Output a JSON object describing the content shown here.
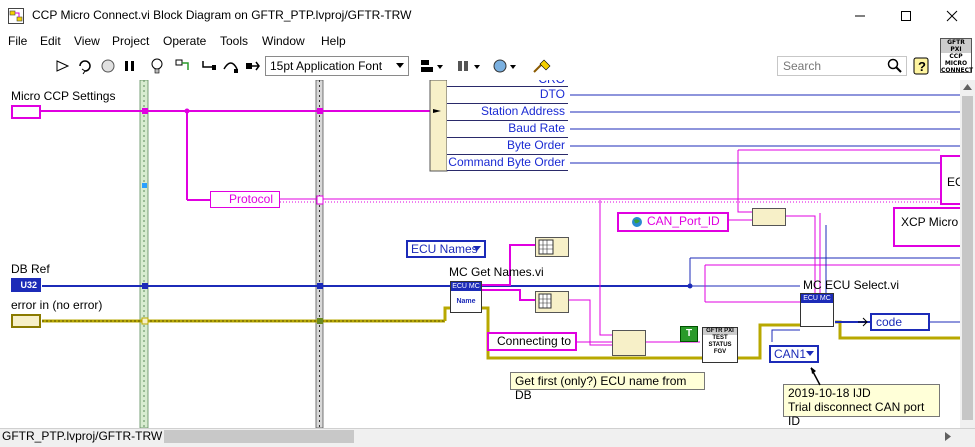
{
  "window": {
    "title": "CCP Micro Connect.vi Block Diagram on GFTR_PTP.lvproj/GFTR-TRW",
    "minimize_icon": "minimize-icon",
    "maximize_icon": "maximize-icon",
    "close_icon": "close-icon"
  },
  "menu": [
    "File",
    "Edit",
    "View",
    "Project",
    "Operate",
    "Tools",
    "Window",
    "Help"
  ],
  "toolbar": {
    "font": "15pt Application Font",
    "search_placeholder": "Search",
    "vi_icon_lines": [
      "GFTR PXI",
      "CCP",
      "MICRO",
      "CONNECT"
    ]
  },
  "diagram": {
    "micro_ccp_settings": "Micro CCP Settings",
    "db_ref": "DB Ref",
    "db_ref_type": "U32",
    "error_in": "error in (no error)",
    "protocol": "Protocol",
    "bundle_fields": [
      "CRO",
      "DTO",
      "Station Address",
      "Baud Rate",
      "Byte Order",
      "Command Byte Order"
    ],
    "can_port_id": "CAN_Port_ID",
    "ecu_names": "ECU Names",
    "mc_get_names": "MC Get Names.vi",
    "get_names_icon": [
      "ECU MC",
      "Name"
    ],
    "mc_ecu_select": "MC ECU Select.vi",
    "ecu_select_icon": "ECU MC",
    "code": "code",
    "connecting_to": "Connecting to",
    "test_status_fgv": [
      "GFTR PXI",
      "TEST",
      "STATUS",
      "FGV"
    ],
    "true_const": "T",
    "can1": "CAN1",
    "comment_get_first": "Get first (only?) ECU name from DB",
    "comment_trial": [
      "2019-10-18 IJD",
      "Trial disconnect CAN port ID"
    ],
    "xcp_micro": "XCP Micro",
    "ec_partial": "EC"
  },
  "status": {
    "path": "GFTR_PTP.lvproj/GFTR-TRW"
  },
  "colors": {
    "pink_wire": "#e000e0",
    "blue_wire": "#1c2bb8",
    "error_wire": "#b8a800",
    "green_wire": "#2a9a2a"
  }
}
